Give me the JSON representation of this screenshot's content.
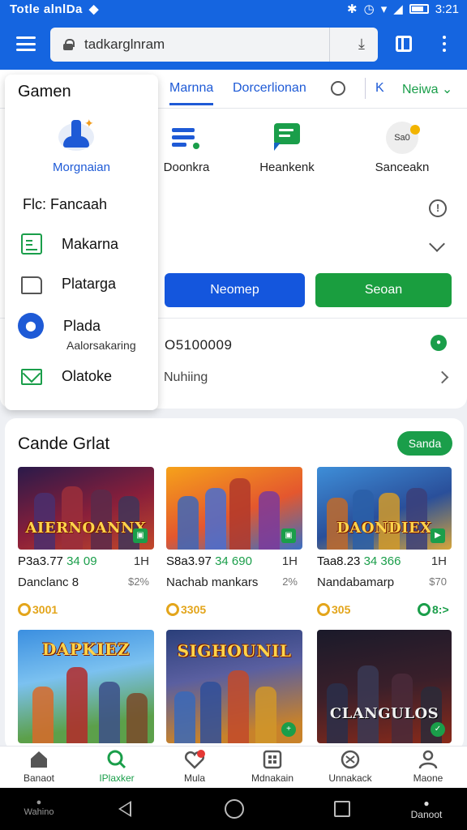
{
  "status_bar": {
    "left_text": "Totle alnlDa",
    "time": "3:21"
  },
  "browser": {
    "url": "tadkarglnram"
  },
  "tabs": {
    "items": [
      "Marnna",
      "Dorcerlionan"
    ],
    "k_label": "K",
    "new_label": "Neiwa"
  },
  "quick_actions": [
    {
      "label": "Doonkra",
      "icon": "list-icon"
    },
    {
      "label": "Heankenk",
      "icon": "chat-icon"
    },
    {
      "label": "Sanceakn",
      "icon": "badge-icon",
      "icon_text": "Sa0"
    }
  ],
  "buttons": {
    "primary": "Neomep",
    "secondary": "Seoan"
  },
  "info": {
    "value": "O5100009",
    "input_value": "Nuhiing"
  },
  "drawer": {
    "title": "Gamen",
    "profile_label": "Morgnaian",
    "file_label": "Flc:  Fancaah",
    "items": [
      {
        "label": "Makarna"
      },
      {
        "label": "Platarga"
      },
      {
        "label": "Plada",
        "sub": "Aalorsakaring"
      },
      {
        "label": "Olatoke"
      }
    ]
  },
  "games": {
    "title": "Cande Grlat",
    "pill": "Sanda",
    "list": [
      {
        "art_title": "AIERNOANNX",
        "price": "P3a3.77",
        "price_highlight": "34 09",
        "hours": "1H",
        "name": "Danclanc 8",
        "pct": "$2%",
        "coins": "3001"
      },
      {
        "art_title": "",
        "price": "S8a3.97",
        "price_highlight": "34 690",
        "hours": "1H",
        "name": "Nachab mankars",
        "pct": "2%",
        "coins": "3305"
      },
      {
        "art_title": "DAONDIEX",
        "price": "Taa8.23",
        "price_highlight": "34 366",
        "hours": "1H",
        "name": "Nandabamarp",
        "pct": "$70",
        "coins": "305",
        "extra": "8:>"
      },
      {
        "art_title": "DAPKIEZ",
        "price": "",
        "price_highlight": "",
        "hours": "",
        "name": "",
        "pct": "",
        "coins": ""
      },
      {
        "art_title": "SIGHOUNIL",
        "price": "",
        "price_highlight": "",
        "hours": "",
        "name": "",
        "pct": "",
        "coins": ""
      },
      {
        "art_title": "CLANGULOS",
        "price": "",
        "price_highlight": "",
        "hours": "",
        "name": "",
        "pct": "",
        "coins": ""
      }
    ]
  },
  "bottom_nav": [
    {
      "label": "Banaot",
      "icon": "home-icon"
    },
    {
      "label": "IPlaxker",
      "icon": "search-icon",
      "active": true
    },
    {
      "label": "Mula",
      "icon": "heart-icon"
    },
    {
      "label": "Mdnakain",
      "icon": "grid-icon"
    },
    {
      "label": "Unnakack",
      "icon": "globe-icon"
    },
    {
      "label": "Maone",
      "icon": "profile-icon"
    }
  ],
  "system_nav": {
    "left": "Wahino",
    "right": "Danoot"
  },
  "colors": {
    "brand_blue": "#1565e0",
    "green": "#1a9e4a",
    "coin": "#e3a51b"
  }
}
